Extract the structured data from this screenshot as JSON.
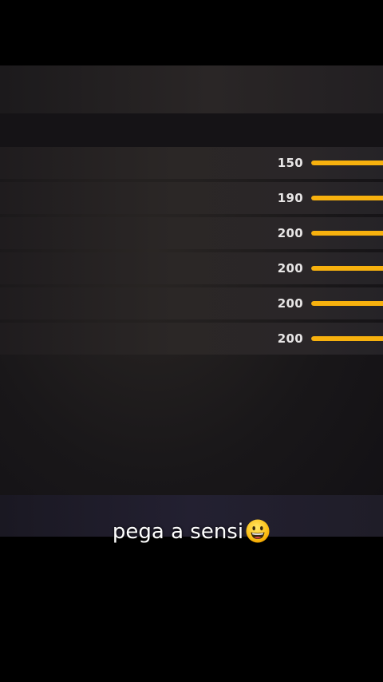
{
  "sensitivity": {
    "rows": [
      {
        "value": "150",
        "level": 1.0
      },
      {
        "value": "190",
        "level": 1.0
      },
      {
        "value": "200",
        "level": 1.0
      },
      {
        "value": "200",
        "level": 1.0
      },
      {
        "value": "200",
        "level": 1.0
      },
      {
        "value": "200",
        "level": 1.0
      }
    ],
    "slider_color": "#f7b10e"
  },
  "caption": {
    "text": "pega a sensi",
    "emoji_icon": "grinning-face-icon"
  }
}
